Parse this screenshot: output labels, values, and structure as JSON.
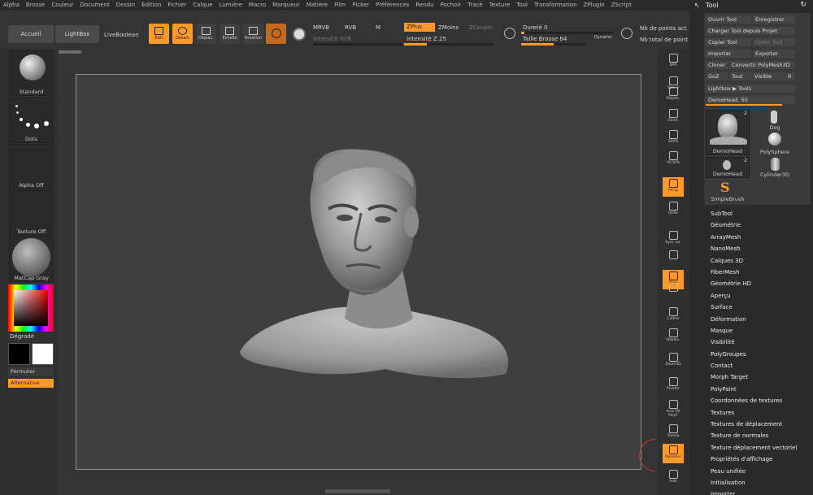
{
  "menu": [
    "Alpha",
    "Brosse",
    "Couleur",
    "Document",
    "Dessin",
    "Edition",
    "Fichier",
    "Calque",
    "Lumière",
    "Macro",
    "Marqueur",
    "Matière",
    "Film",
    "Picker",
    "Préférences",
    "Rendu",
    "Pochoir",
    "Tracé",
    "Texture",
    "Tool",
    "Transformation",
    "ZPlugin",
    "ZScript"
  ],
  "toolbar": {
    "accueil": "Accueil",
    "lightbox": "LightBox",
    "liveboolean": "LiveBoolean",
    "edit": "Edit",
    "dessin": "Dessin",
    "deplacer": "Déplac.",
    "echelle": "Échelle",
    "rotation": "Rotation",
    "mrvb": "MRVB",
    "rvb": "RVB",
    "m": "M",
    "zplus": "ZPlus",
    "zmoins": "ZMoins",
    "zcouper": "ZCouper",
    "intensite_rvb": "Intensité RVB",
    "intensite_z": "Intensité Z 25",
    "durete": "Dureté 0",
    "taille_brosse": "Taille Brosse 64",
    "dynamic": "Dynamic",
    "nb_points_act": "Nb de points act",
    "nb_total_points": "Nb total de point",
    "intensite_z_value": 0.25,
    "taille_brosse_value": 0.5
  },
  "left": {
    "brush": "Standard",
    "stroke": "Dots",
    "alpha": "Alpha Off",
    "texture": "Texture Off",
    "material": "MatCap Gray",
    "gradient": "Dégradé",
    "swap": "Permuter",
    "alternate": "Alternative",
    "main_color": "#000000",
    "secondary_color": "#ffffff"
  },
  "rightshelf": [
    {
      "label": "BPR",
      "on": false
    },
    {
      "label": "Spix 3",
      "on": false
    },
    {
      "label": "Déplac.",
      "on": false
    },
    {
      "label": "Zoom",
      "on": false
    },
    {
      "label": "100%",
      "on": false
    },
    {
      "label": "AC50%",
      "on": false
    },
    {
      "label": "Persp",
      "on": true
    },
    {
      "label": "Grille",
      "on": false
    },
    {
      "label": "Sym. Lo.",
      "on": false
    },
    {
      "label": "",
      "on": false
    },
    {
      "label": "Qxyz",
      "on": true
    },
    {
      "label": "",
      "on": false
    },
    {
      "label": "Cadrer",
      "on": false
    },
    {
      "label": "Déplac.",
      "on": false
    },
    {
      "label": "Zoom3D",
      "on": false
    },
    {
      "label": "Pivoter",
      "on": false
    },
    {
      "label": "Line Fill PolyF",
      "on": false
    },
    {
      "label": "Transp",
      "on": false
    },
    {
      "label": "Dynamic",
      "on": true
    },
    {
      "label": "Solo",
      "on": false
    }
  ],
  "tool": {
    "title": "Tool",
    "ouvrir": "Ouvrir Tool",
    "enregistrer": "Enregistrer",
    "charger": "Charger Tool depuis Projet",
    "copier": "Copier Tool",
    "coller": "Coller Tool",
    "importer": "Importer",
    "exporter": "Exporter",
    "cloner": "Cloner",
    "convertir": "Convertir PolyMesh3D",
    "goz": "GoZ",
    "tout": "Tout",
    "visible": "Visible",
    "r": "R",
    "lightbox_tools": "Lightbox ▶ Tools",
    "demohead_slider": "DemoHead. 50",
    "thumbs": [
      {
        "name": "DemoHead",
        "count": "2"
      },
      {
        "name": "Dog",
        "count": ""
      },
      {
        "name": "PolySphere",
        "count": ""
      },
      {
        "name": "DemoHead",
        "count": "2"
      },
      {
        "name": "Cylinder3D",
        "count": ""
      },
      {
        "name": "SimpleBrush",
        "count": ""
      }
    ],
    "sections": [
      "SubTool",
      "Géométrie",
      "ArrayMesh",
      "NanoMesh",
      "Calques 3D",
      "FiberMesh",
      "Géométrie HD",
      "Aperçu",
      "Surface",
      "Déformation",
      "Masque",
      "Visibilité",
      "PolyGroupes",
      "Contact",
      "Morph Target",
      "PolyPaint",
      "Coordonnées de textures",
      "Textures",
      "Textures de déplacement",
      "Texture de normales",
      "Texture déplacement vectoriel",
      "Propriétés d'affichage",
      "Peau unifiée",
      "Initialisation",
      "Importer"
    ]
  },
  "colors": {
    "accent": "#ff9a2a"
  }
}
